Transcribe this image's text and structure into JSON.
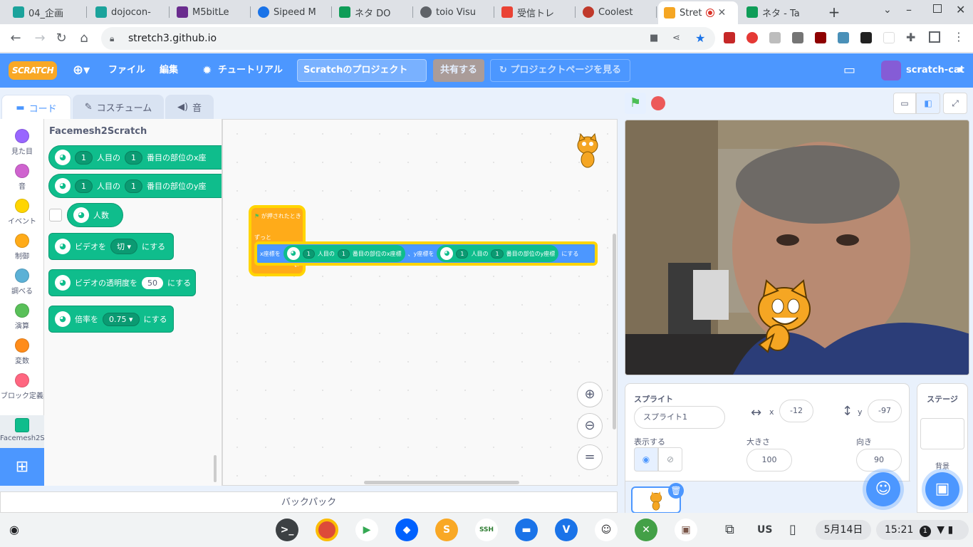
{
  "browser": {
    "tabs": [
      "04_企画",
      "dojocon-",
      "M5bitLe",
      "Sipeed M",
      "ネタ DO",
      "toio Visu",
      "受信トレ",
      "Coolest",
      "Stret",
      "ネタ - Ta"
    ],
    "url": "stretch3.github.io"
  },
  "menubar": {
    "logo": "SCRATCH",
    "file": "ファイル",
    "edit": "編集",
    "tutorial": "チュートリアル",
    "project_title": "Scratchのプロジェクト",
    "share": "共有する",
    "project_page": "プロジェクトページを見る",
    "user": "scratch-cat"
  },
  "editor_tabs": {
    "code": "コード",
    "costume": "コスチューム",
    "sound": "音"
  },
  "categories": [
    "見た目",
    "音",
    "イベント",
    "制御",
    "調べる",
    "演算",
    "変数",
    "ブロック定義",
    "Facemesh2S"
  ],
  "palette": {
    "title": "Facemesh2Scratch",
    "b1": {
      "n1": "1",
      "t1": "人目の",
      "n2": "1",
      "t2": "番目の部位のx座"
    },
    "b2": {
      "n1": "1",
      "t1": "人目の",
      "n2": "1",
      "t2": "番目の部位のy座"
    },
    "b3": "人数",
    "b4": {
      "t1": "ビデオを",
      "opt": "切",
      "t2": "にする"
    },
    "b5": {
      "t1": "ビデオの透明度を",
      "val": "50",
      "t2": "にする"
    },
    "b6": {
      "t1": "倍率を",
      "opt": "0.75",
      "t2": "にする"
    }
  },
  "script": {
    "hat": "が押されたとき",
    "forever": "ずっと",
    "motion": {
      "t1": "x座標を",
      "n1": "1",
      "a": "人目の",
      "n2": "1",
      "b": "番目の部位のx座標",
      "t2": "、y座標を",
      "n3": "1",
      "c": "人目の",
      "n4": "1",
      "d": "番目の部位のy座標",
      "t3": "にする"
    }
  },
  "backpack": "バックパック",
  "sprite": {
    "label": "スプライト",
    "name": "スプライト1",
    "x_label": "x",
    "x": "-12",
    "y_label": "y",
    "y": "-97",
    "show_label": "表示する",
    "size_label": "大きさ",
    "size": "100",
    "dir_label": "向き",
    "dir": "90"
  },
  "stage_pane": {
    "title": "ステージ",
    "backdrop": "背景"
  },
  "shelf": {
    "ime": "US",
    "date": "5月14日",
    "time": "15:21",
    "notif": "1"
  }
}
